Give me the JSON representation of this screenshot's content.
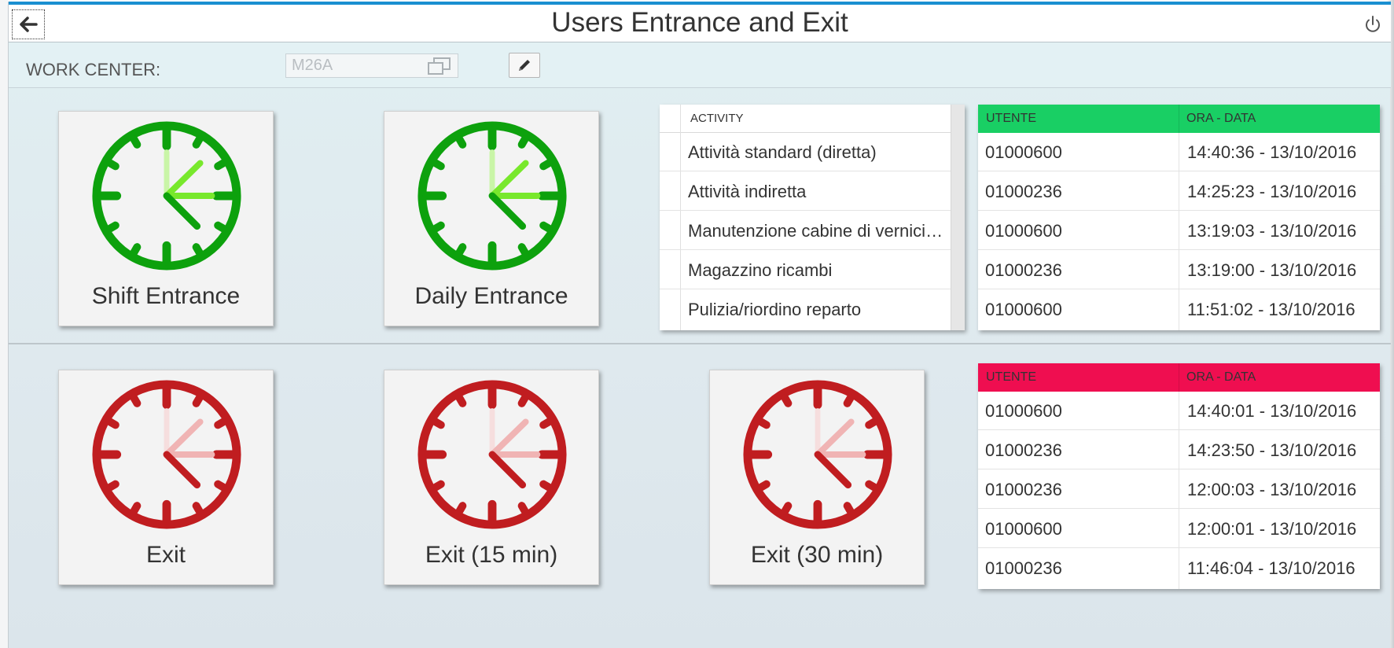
{
  "header": {
    "title": "Users Entrance and Exit",
    "back_icon": "arrow-left-icon",
    "power_icon": "power-icon"
  },
  "work_center": {
    "label": "WORK CENTER:",
    "value": "M26A",
    "value_help_icon": "value-help-icon",
    "edit_icon": "pencil-icon"
  },
  "colors": {
    "accent": "#1a8fd1",
    "entrance_green": "#19cf64",
    "exit_red": "#ef0e50",
    "clock_green": "#0da10d",
    "clock_red": "#c01d20"
  },
  "entrance_tiles": [
    {
      "label": "Shift Entrance",
      "icon": "green-clock-icon"
    },
    {
      "label": "Daily Entrance",
      "icon": "green-clock-icon"
    }
  ],
  "exit_tiles": [
    {
      "label": "Exit",
      "icon": "red-clock-icon"
    },
    {
      "label": "Exit (15 min)",
      "icon": "red-clock-icon"
    },
    {
      "label": "Exit (30 min)",
      "icon": "red-clock-icon"
    }
  ],
  "activity_table": {
    "header": "ACTIVITY",
    "rows": [
      "Attività standard (diretta)",
      "Attività indiretta",
      "Manutenzione cabine di verniciatura",
      "Magazzino ricambi",
      "Pulizia/riordino reparto"
    ]
  },
  "entrance_log": {
    "headers": [
      "UTENTE",
      "ORA - DATA"
    ],
    "rows": [
      [
        "01000600",
        "14:40:36 - 13/10/2016"
      ],
      [
        "01000236",
        "14:25:23 - 13/10/2016"
      ],
      [
        "01000600",
        "13:19:03 - 13/10/2016"
      ],
      [
        "01000236",
        "13:19:00 - 13/10/2016"
      ],
      [
        "01000600",
        "11:51:02 - 13/10/2016"
      ]
    ]
  },
  "exit_log": {
    "headers": [
      "UTENTE",
      "ORA - DATA"
    ],
    "rows": [
      [
        "01000600",
        "14:40:01 - 13/10/2016"
      ],
      [
        "01000236",
        "14:23:50 - 13/10/2016"
      ],
      [
        "01000236",
        "12:00:03 - 13/10/2016"
      ],
      [
        "01000600",
        "12:00:01 - 13/10/2016"
      ],
      [
        "01000236",
        "11:46:04 - 13/10/2016"
      ]
    ]
  }
}
